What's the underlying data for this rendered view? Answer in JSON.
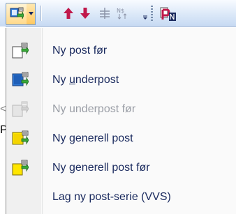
{
  "toolbar": {
    "buttons": [
      {
        "name": "new-post-split",
        "icon": "new-post-icon"
      },
      {
        "name": "move-up",
        "icon": "arrow-up-icon"
      },
      {
        "name": "move-down",
        "icon": "arrow-down-icon"
      },
      {
        "name": "indent",
        "icon": "indent-icon"
      },
      {
        "name": "renumber",
        "icon": "renumber-icon"
      },
      {
        "name": "options",
        "icon": "toolbar-options-icon"
      },
      {
        "name": "print-preview",
        "icon": "print-preview-icon"
      }
    ]
  },
  "menu": {
    "items": [
      {
        "pre": "Ny post før",
        "u": "",
        "post": "",
        "disabled": false,
        "icon": "new-post-before-icon"
      },
      {
        "pre": "Ny ",
        "u": "u",
        "post": "nderpost",
        "disabled": false,
        "icon": "new-subpost-icon"
      },
      {
        "pre": "Ny underpost før",
        "u": "",
        "post": "",
        "disabled": true,
        "icon": "new-subpost-before-icon"
      },
      {
        "pre": "Ny ",
        "u": "g",
        "post": "enerell post",
        "disabled": false,
        "icon": "new-general-post-icon"
      },
      {
        "pre": "Ny ",
        "u": "g",
        "post": "enerell post før",
        "disabled": false,
        "icon": "new-general-post-before-icon"
      },
      {
        "pre": "Lag ny post-serie (VVS)",
        "u": "",
        "post": "",
        "disabled": false,
        "icon": ""
      }
    ]
  },
  "colors": {
    "arrow": "#c0184a",
    "menu_text": "#1a2a5e",
    "disabled_text": "#9a9ea6"
  }
}
